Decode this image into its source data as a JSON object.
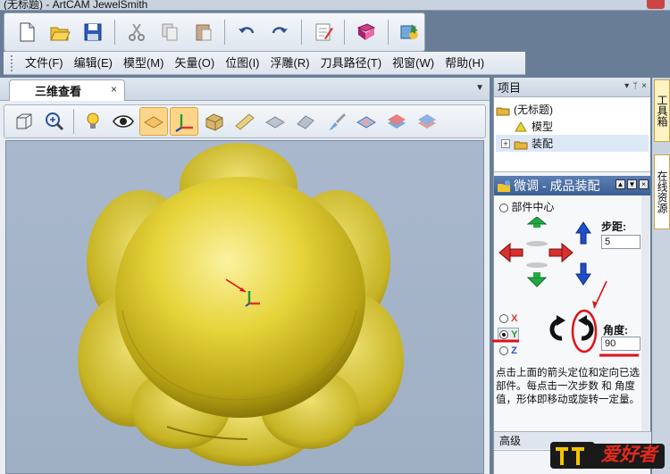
{
  "window": {
    "title": "(无标题) - ArtCAM JewelSmith"
  },
  "toolbar_main": {
    "buttons": [
      {
        "icon": "new-file-icon"
      },
      {
        "icon": "open-folder-icon"
      },
      {
        "icon": "save-icon"
      },
      {
        "icon": "cut-icon"
      },
      {
        "icon": "copy-icon"
      },
      {
        "icon": "paste-icon"
      },
      {
        "icon": "undo-icon"
      },
      {
        "icon": "redo-icon"
      },
      {
        "icon": "notes-icon"
      },
      {
        "icon": "book-icon"
      },
      {
        "icon": "wizard-icon"
      }
    ]
  },
  "menu": {
    "items": [
      "文件(F)",
      "编辑(E)",
      "模型(M)",
      "矢量(O)",
      "位图(I)",
      "浮雕(R)",
      "刀具路径(T)",
      "视窗(W)",
      "帮助(H)"
    ]
  },
  "view": {
    "tab_label": "三维查看",
    "close_glyph": "×",
    "menu_glyph": "▼"
  },
  "toolbar_view": {
    "buttons": [
      {
        "icon": "wireframe-box-icon",
        "active": false
      },
      {
        "icon": "zoom-icon",
        "active": false
      },
      {
        "icon": "light-bulb-icon",
        "active": false
      },
      {
        "icon": "eye-icon",
        "active": false
      },
      {
        "icon": "plane-view-icon",
        "active": true
      },
      {
        "icon": "axes-icon",
        "active": true
      },
      {
        "icon": "box-shade-icon",
        "active": false
      },
      {
        "icon": "ruler-icon",
        "active": false
      },
      {
        "icon": "flat-shade-icon",
        "active": false
      },
      {
        "icon": "iso-shade-icon",
        "active": false
      },
      {
        "icon": "brush-icon",
        "active": false
      },
      {
        "icon": "layers-icon",
        "active": false
      },
      {
        "icon": "layers-red-icon",
        "active": false
      },
      {
        "icon": "layers-blue-icon",
        "active": false
      }
    ]
  },
  "project_panel": {
    "title": "项目",
    "pin_glyph": "ᛘ",
    "close_glyph": "×",
    "tree": [
      {
        "label": "(无标题)",
        "indent": 0
      },
      {
        "label": "模型",
        "indent": 1
      },
      {
        "label": "装配",
        "indent": 1,
        "selected": true
      }
    ]
  },
  "tune_panel": {
    "title": "微调 - 成品装配",
    "radio_center": "部件中心",
    "step_label": "步距:",
    "step_value": "5",
    "axis_x": "X",
    "axis_y": "Y",
    "axis_z": "Z",
    "selected_axis": "Y",
    "angle_label": "角度:",
    "angle_value": "90",
    "description": "点击上面的箭头定位和定向已选部件。每点击一次步数 和 角度 值，形体即移动或旋转一定量。",
    "advanced": "高级"
  },
  "side_tabs": {
    "toolbox": "工具箱",
    "online": "在线资源"
  },
  "brand": {
    "text": "爱好者",
    "colors": {
      "yellow": "#f5c400",
      "red": "#e42a1a"
    }
  },
  "colors": {
    "model": "#e6d43a",
    "viewport_bg": "#a6b6cb",
    "annotation_red": "#e0101a"
  }
}
